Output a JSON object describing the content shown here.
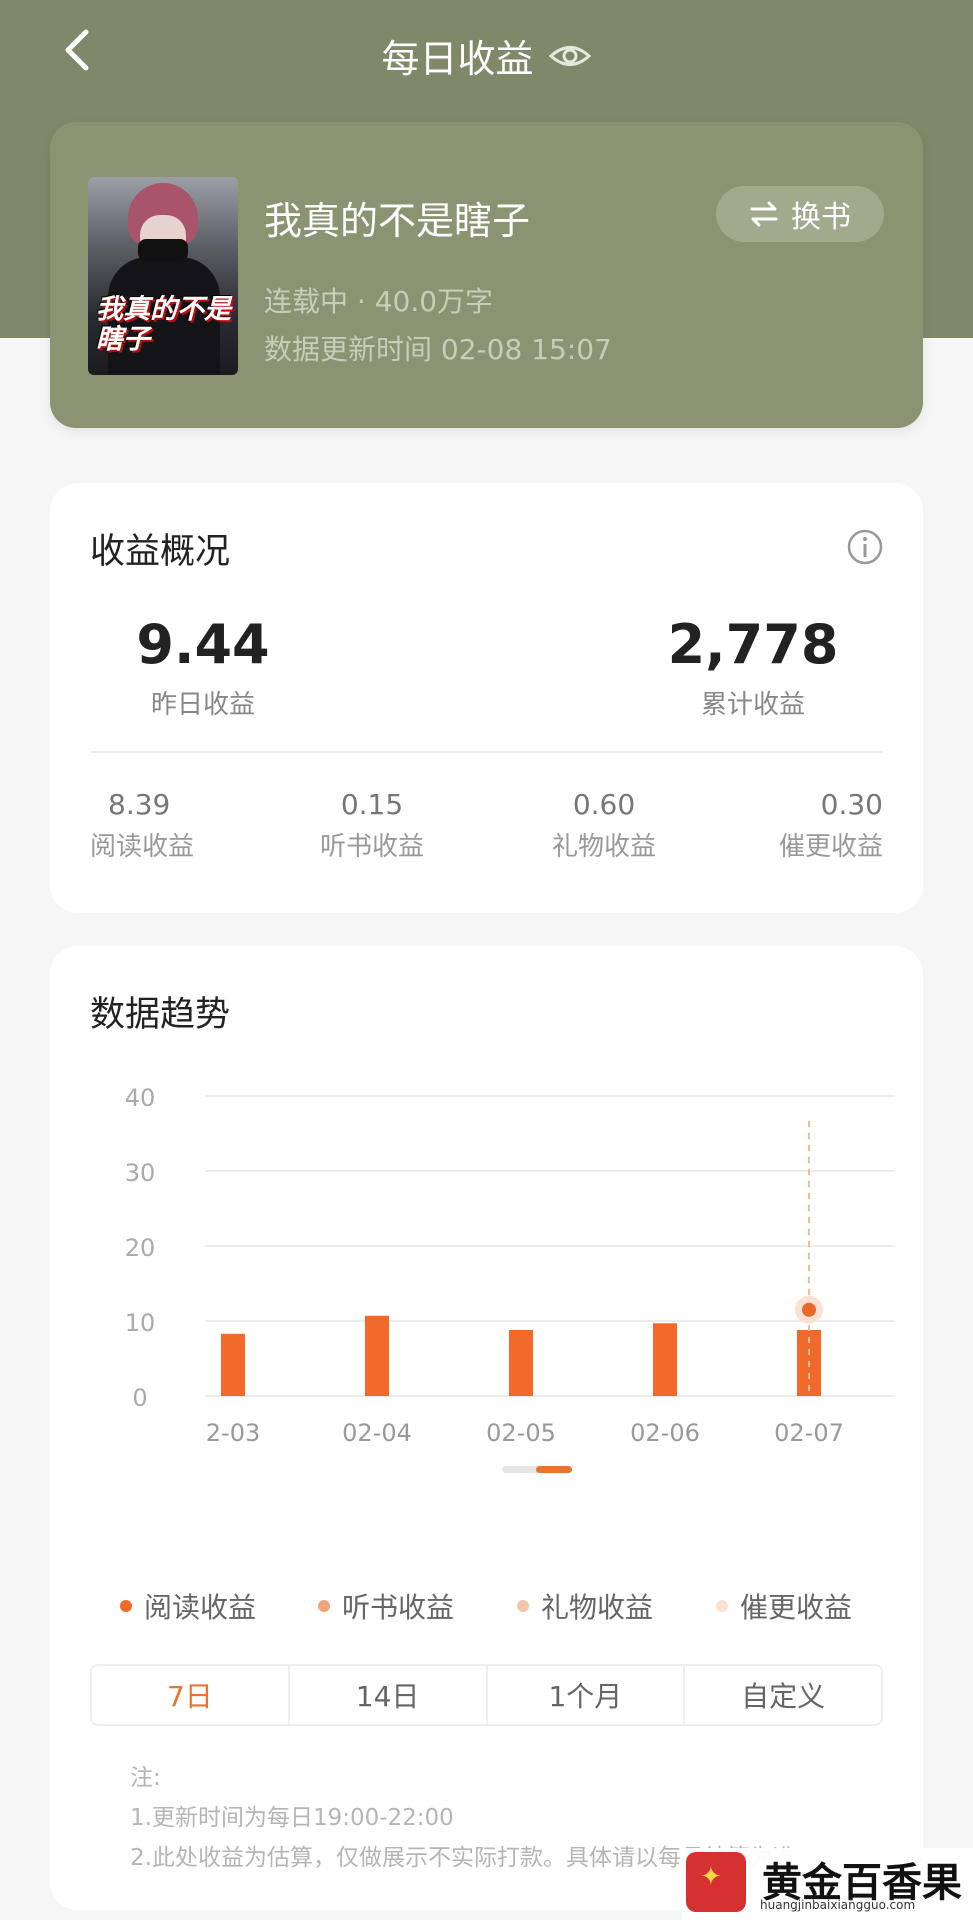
{
  "header": {
    "title": "每日收益"
  },
  "book": {
    "title": "我真的不是瞎子",
    "status_line": "连载中 · 40.0万字",
    "update_line": "数据更新时间 02-08 15:07",
    "swap_label": "换书",
    "cover_title": "我真的不是瞎子"
  },
  "overview": {
    "title": "收益概况",
    "yesterday": {
      "value": "9.44",
      "label": "昨日收益"
    },
    "total": {
      "value": "2,778",
      "label": "累计收益"
    },
    "breakdown": [
      {
        "value": "8.39",
        "label": "阅读收益"
      },
      {
        "value": "0.15",
        "label": "听书收益"
      },
      {
        "value": "0.60",
        "label": "礼物收益"
      },
      {
        "value": "0.30",
        "label": "催更收益"
      }
    ]
  },
  "trend": {
    "title": "数据趋势",
    "tabs": [
      "7日",
      "14日",
      "1个月",
      "自定义"
    ],
    "active_tab": "7日",
    "notes": [
      "注:",
      "1.更新时间为每日19:00-22:00",
      "2.此处收益为估算，仅做展示不实际打款。具体请以每月结算为准"
    ]
  },
  "chart_data": {
    "type": "bar",
    "categories": [
      "2-03",
      "02-04",
      "02-05",
      "02-06",
      "02-07"
    ],
    "series": [
      {
        "name": "阅读收益",
        "values": [
          8.3,
          10.7,
          8.8,
          9.7,
          8.8
        ],
        "color": "#f06b2a"
      },
      {
        "name": "听书收益",
        "values": [
          0,
          0,
          0,
          0,
          0
        ],
        "color": "#f0a47a"
      },
      {
        "name": "礼物收益",
        "values": [
          0,
          0,
          0,
          0,
          0
        ],
        "color": "#f3c6ab"
      },
      {
        "name": "催更收益",
        "values": [
          0,
          0,
          0,
          0,
          0
        ],
        "color": "#f7e3d6"
      }
    ],
    "highlight": {
      "category": "02-07",
      "value": 11.5
    },
    "yticks": [
      0,
      10,
      20,
      30,
      40
    ],
    "ylim": [
      0,
      40
    ],
    "grid": true,
    "legend": "bottom"
  },
  "watermark": {
    "name": "黄金百香果",
    "url": "huangjinbaixiangguo.com"
  },
  "colors": {
    "header_bg": "#80886a",
    "accent": "#e8742d",
    "bar": "#f06b2a"
  }
}
